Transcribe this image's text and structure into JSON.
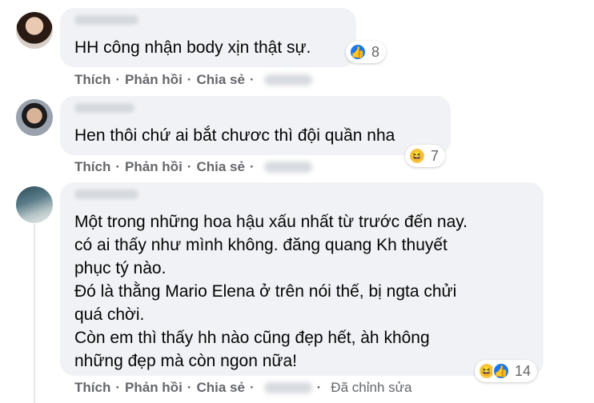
{
  "comments": [
    {
      "lines": [
        "HH công nhận body xịn thật sự."
      ],
      "actions": {
        "like": "Thích",
        "reply": "Phản hồi",
        "share": "Chia sẻ",
        "sep": "·"
      },
      "reaction": {
        "icons": [
          "like-icon"
        ],
        "count": "8"
      },
      "edited": ""
    },
    {
      "lines": [
        "Hen thôi chứ ai bắt chươc thì đội quần nha"
      ],
      "actions": {
        "like": "Thích",
        "reply": "Phản hồi",
        "share": "Chia sẻ",
        "sep": "·"
      },
      "reaction": {
        "icons": [
          "haha-icon"
        ],
        "count": "7"
      },
      "edited": ""
    },
    {
      "lines": [
        "Một trong những hoa hậu xấu nhất từ trước đến nay.",
        "có ai thấy như mình không. đăng quang Kh thuyết",
        "phục tý nào.",
        "Đó là thằng Mario Elena ở trên nói thế, bị ngta chửi",
        "quá chời.",
        "Còn em thì thấy hh nào cũng đẹp hết, àh không",
        "những đẹp mà còn ngon nữa!"
      ],
      "actions": {
        "like": "Thích",
        "reply": "Phản hồi",
        "share": "Chia sẻ",
        "sep": "·"
      },
      "reaction": {
        "icons": [
          "haha-icon",
          "like-icon"
        ],
        "count": "14"
      },
      "edited": "Đã chỉnh sửa"
    }
  ],
  "icons": {
    "like": "👍",
    "haha": "😆"
  }
}
